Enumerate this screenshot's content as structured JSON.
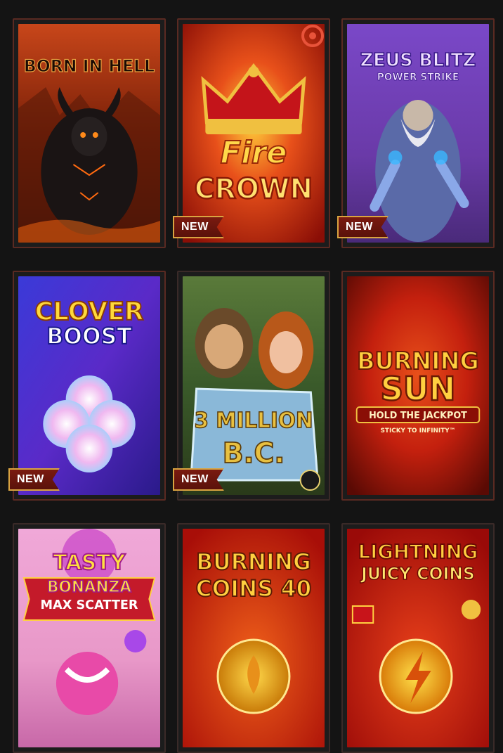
{
  "badge_label": "NEW",
  "games": [
    {
      "title_line1": "BORN IN HELL",
      "title_line2": "",
      "is_new": false
    },
    {
      "title_line1": "Fire",
      "title_line2": "CROWN",
      "is_new": true
    },
    {
      "title_line1": "ZEUS BLITZ",
      "title_line2": "POWER STRIKE",
      "is_new": true
    },
    {
      "title_line1": "CLOVER",
      "title_line2": "BOOST",
      "is_new": true
    },
    {
      "title_line1": "3 MILLION",
      "title_line2": "B.C.",
      "is_new": true
    },
    {
      "title_line1": "BURNING",
      "title_line2": "SUN",
      "tagline1": "HOLD THE JACKPOT",
      "tagline2": "STICKY TO INFINITY™",
      "is_new": false
    },
    {
      "title_line1": "TASTY",
      "title_line2": "BONANZA",
      "tagline1": "MAX SCATTER",
      "is_new": false
    },
    {
      "title_line1": "BURNING",
      "title_line2": "COINS 40",
      "is_new": false
    },
    {
      "title_line1": "LIGHTNING",
      "title_line2": "JUICY COINS",
      "is_new": false
    }
  ],
  "colors": {
    "page_bg": "#141414",
    "badge_bg": "#7a1a10",
    "badge_border": "#d9a441",
    "fav_icon": "#e8533a"
  }
}
